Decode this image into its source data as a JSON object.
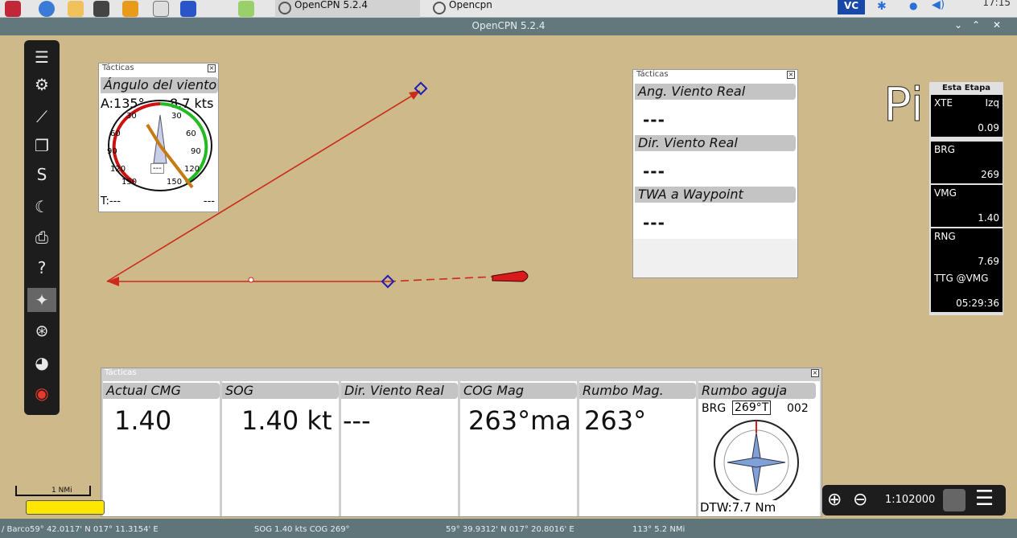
{
  "taskbar": {
    "tasks": [
      "OpenCPN 5.2.4",
      "Opencpn"
    ],
    "clock": "17:15",
    "tray_label": "VC"
  },
  "window": {
    "title": "OpenCPN 5.2.4"
  },
  "toolbar_icons": [
    "menu-icon",
    "settings-icon",
    "route-icon",
    "layers-icon",
    "track-icon",
    "tide-icon",
    "print-icon",
    "help-icon",
    "mob-icon",
    "ais-icon",
    "dashboard-icon",
    "lifebuoy-icon"
  ],
  "wind_panel": {
    "title": "Tácticas",
    "header": "Ángulo del viento",
    "apparent": "A:135°",
    "speed": "8.7 kts",
    "true": "T:---",
    "true_right": "---",
    "center": "---",
    "dial_labels": [
      "30",
      "30",
      "60",
      "60",
      "90",
      "90",
      "120",
      "120",
      "150",
      "150"
    ]
  },
  "true_panel": {
    "title": "Tácticas",
    "rows": [
      {
        "header": "Ang. Viento Real",
        "value": "---"
      },
      {
        "header": "Dir. Viento Real",
        "value": "---"
      },
      {
        "header": "TWA a Waypoint",
        "value": "---"
      }
    ]
  },
  "right_panel": {
    "title": "Esta Etapa",
    "items": [
      {
        "label": "XTE",
        "label2": "Izq",
        "value": "0.09"
      },
      {
        "label": "BRG",
        "value": "269"
      },
      {
        "label": "VMG",
        "value": "1.40"
      },
      {
        "label": "RNG",
        "value": "7.69"
      },
      {
        "label": "TTG @VMG",
        "value": "05:29:36"
      }
    ]
  },
  "pi_letter": "Pi",
  "bottom_panel": {
    "title": "Tácticas",
    "columns": [
      {
        "header": "Actual CMG",
        "value": "1.40"
      },
      {
        "header": "SOG",
        "value": "1.40 kt"
      },
      {
        "header": "Dir. Viento Real",
        "value": "---"
      },
      {
        "header": "COG Mag",
        "value": "263°ma"
      },
      {
        "header": "Rumbo Mag.",
        "value": "263°"
      },
      {
        "header": "Rumbo aguja",
        "value": ""
      }
    ],
    "compass": {
      "brg_label": "BRG",
      "brg_value": "269°T",
      "brg_right": "002",
      "dtw": "DTW:7.7 Nm"
    }
  },
  "scale_label": "1 NMi",
  "zoom": {
    "scale": "1:102000"
  },
  "status": {
    "pos": "/ Barco59° 42.0117' N  017° 11.3154' E",
    "sogcog": "SOG 1.40 kts  COG 269°",
    "cursor": "59° 39.9312' N  017° 20.8016' E",
    "brgdist": "113°  5.2 NMi"
  },
  "colors": {
    "chart_bg": "#cdb98a",
    "route": "#cc2a1a",
    "dial_red": "#cc1111",
    "dial_green": "#22bb22",
    "toolbar": "#1d1d1d"
  }
}
